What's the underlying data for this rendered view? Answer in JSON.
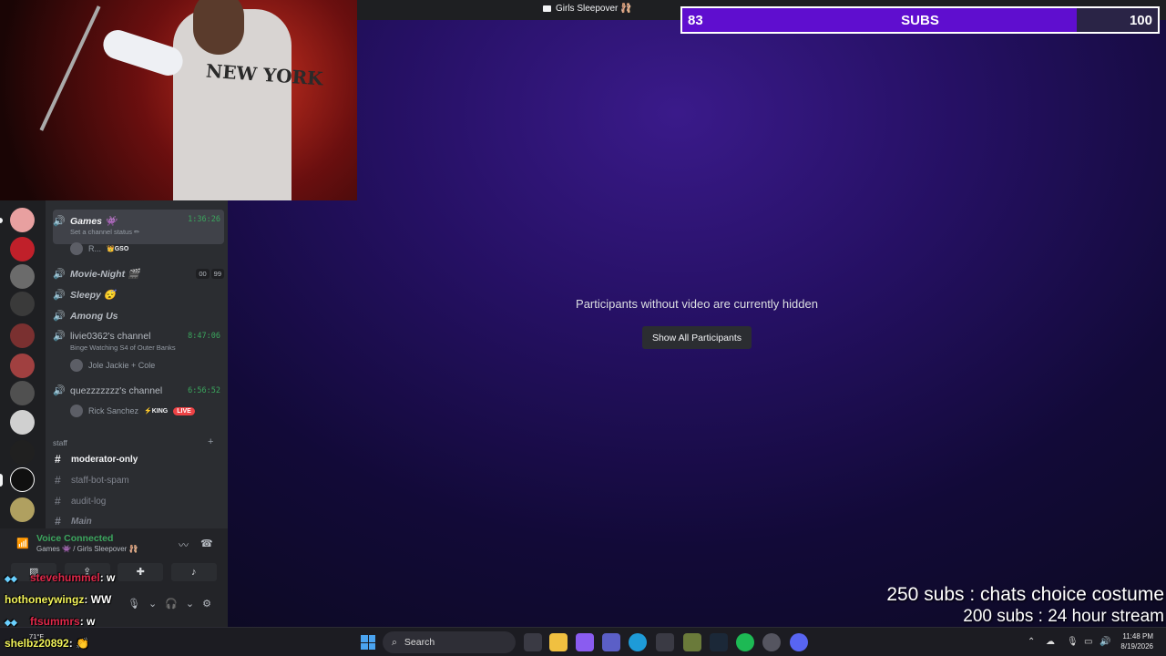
{
  "window": {
    "title": "Girls Sleepover 🩰"
  },
  "stage": {
    "hidden_message": "Participants without video are currently hidden",
    "show_all_label": "Show All Participants"
  },
  "subgoal": {
    "current": "83",
    "label": "SUBS",
    "target": "100",
    "progress_fraction": 0.83
  },
  "webcam": {
    "shirt_text": "NEW YORK"
  },
  "channels": {
    "voice": [
      {
        "name": "Games",
        "emoji": "👾",
        "time": "1:36:26",
        "status": "Set a channel status ✏",
        "member": "R...",
        "member_tag": "👑GSO"
      },
      {
        "name": "Movie-Night",
        "emoji": "🎬",
        "count_a": "00",
        "count_b": "99"
      },
      {
        "name": "Sleepy",
        "emoji": "😴"
      },
      {
        "name": "Among Us"
      },
      {
        "name": "livie0362's channel",
        "time": "8:47:06",
        "status": "Binge Watching S4 of Outer Banks",
        "member": "Jole Jackie + Cole"
      },
      {
        "name": "quezzzzzzz's channel",
        "time": "6:56:52",
        "member": "Rick Sanchez",
        "member_tag": "⚡KING",
        "live": "LIVE"
      }
    ],
    "category": "staff",
    "add": "+",
    "text": [
      {
        "name": "moderator-only"
      },
      {
        "name": "staff-bot-spam"
      },
      {
        "name": "audit-log"
      },
      {
        "name": "Main"
      }
    ]
  },
  "voice_panel": {
    "status": "Voice Connected",
    "location": "Games 👾 / Girls Sleepover 🩰"
  },
  "chat": [
    {
      "user": "stevehummel",
      "msg": ": w"
    },
    {
      "user": "hothoneywingz",
      "msg": ": WW"
    },
    {
      "user": "ftsummrs",
      "msg": ": w"
    },
    {
      "user": "shelbz20892",
      "msg": ": 👏"
    }
  ],
  "goals": [
    {
      "text": "250 subs : chats choice costume"
    },
    {
      "text": "200 subs : 24 hour stream"
    }
  ],
  "taskbar": {
    "weather": "71°F",
    "search_label": "Search",
    "time": "11:48 PM",
    "date": "8/19/2026"
  },
  "colors": {
    "accent": "#5f0ecf",
    "discord_green": "#3ba55d",
    "live_red": "#ed4245"
  }
}
